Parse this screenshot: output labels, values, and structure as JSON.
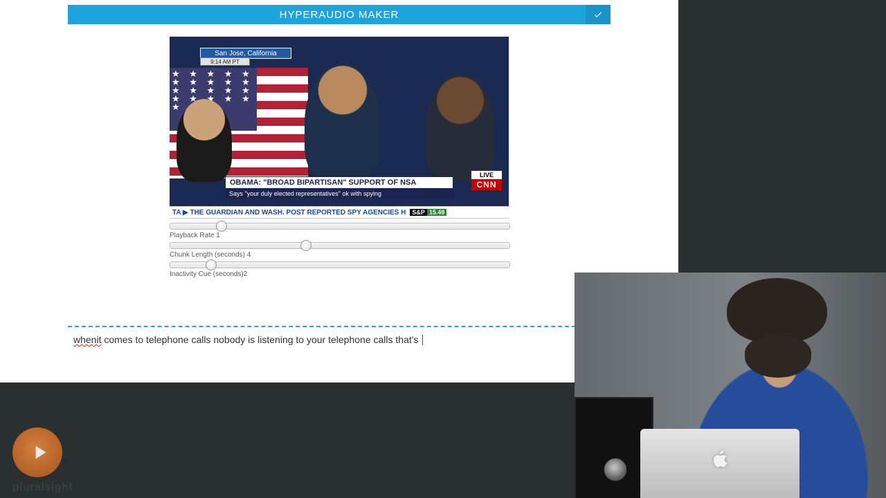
{
  "header": {
    "title": "HYPERAUDIO MAKER"
  },
  "video": {
    "location_tag": "San Jose, California",
    "time_tag": "9:14 AM PT",
    "chyron_line1": "OBAMA: \"BROAD BIPARTISAN\" SUPPORT OF NSA",
    "chyron_line2": "Says \"your duly elected representatives\" ok with spying",
    "live_label": "LIVE",
    "network_logo": "CNN",
    "ticker_text": "TA  ▶  THE GUARDIAN AND WASH. POST REPORTED SPY AGENCIES H",
    "ticker_index_label": "S&P",
    "ticker_index_value": "15.49"
  },
  "sliders": {
    "playback_rate": {
      "label": "Playback Rate",
      "value": "1",
      "pos_pct": 15
    },
    "chunk_length": {
      "label": "Chunk Length (seconds)",
      "value": "4",
      "pos_pct": 40
    },
    "inactivity": {
      "label": "Inactivity Cue (seconds)",
      "value": "2",
      "pos_pct": 12
    }
  },
  "transcript": {
    "misspelled_prefix": "whenit",
    "rest": " comes to telephone calls nobody is listening to your telephone calls that's "
  },
  "watermark": "pluralsight"
}
